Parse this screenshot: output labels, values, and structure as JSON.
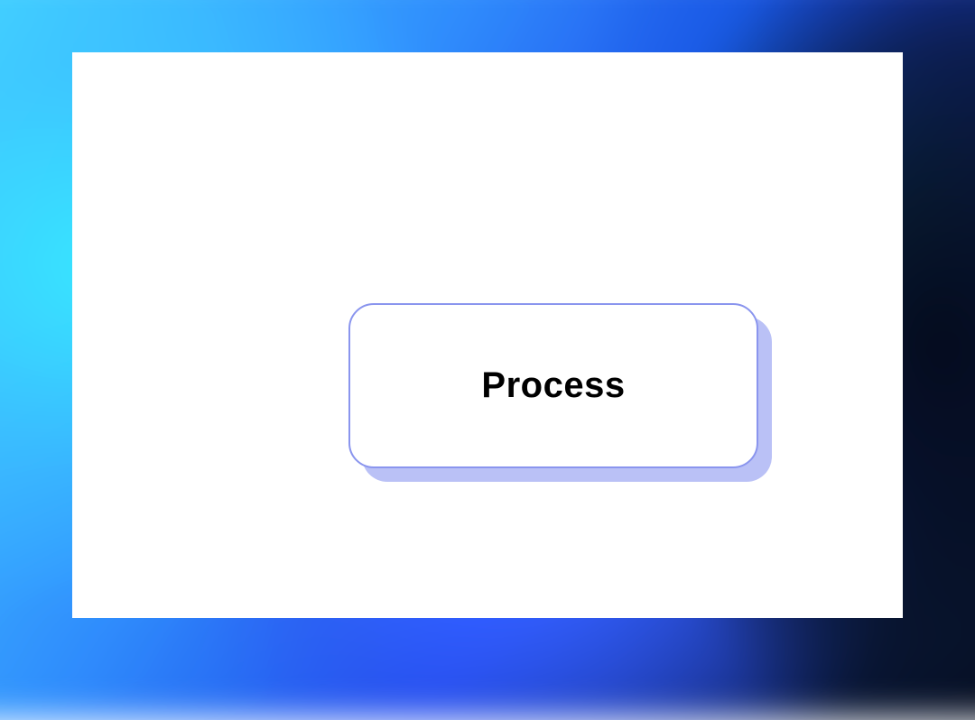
{
  "node": {
    "label": "Process",
    "border_color": "#8a95ee",
    "shadow_color": "#aeb6f5"
  }
}
